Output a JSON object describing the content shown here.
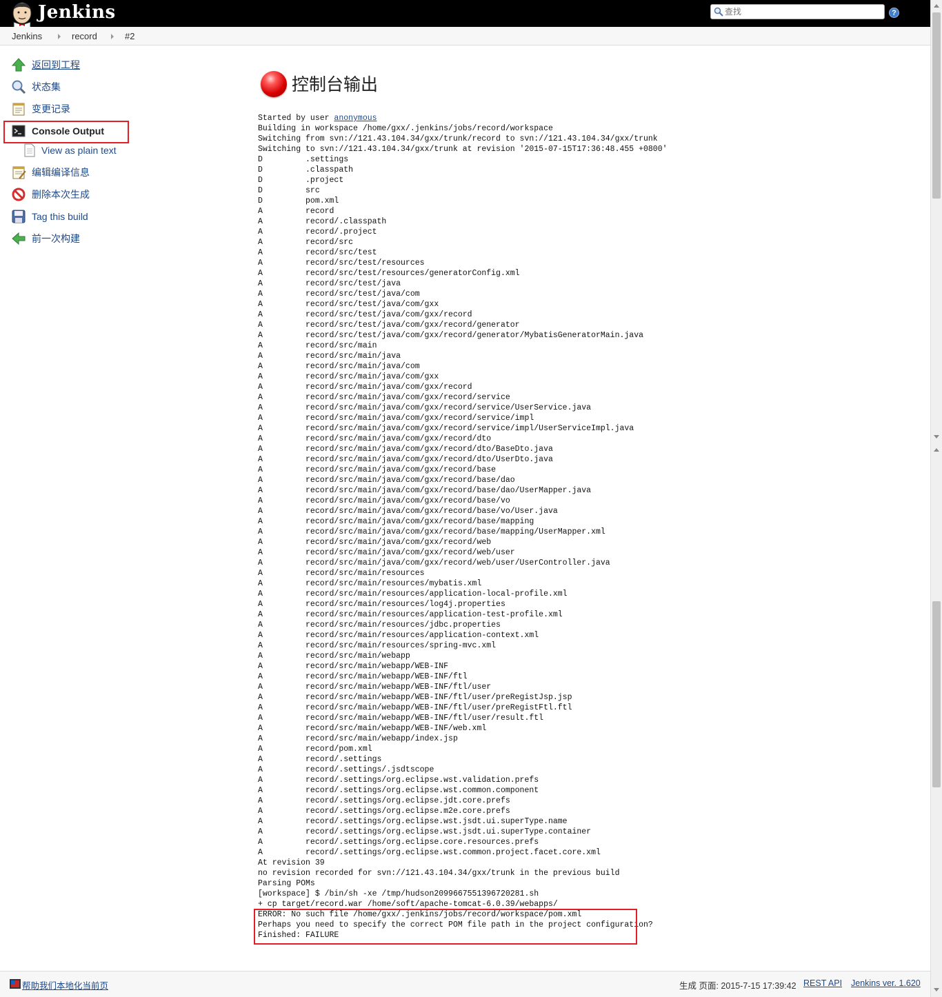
{
  "header": {
    "logo_text": "Jenkins",
    "search_placeholder": "查找",
    "help_label": "?"
  },
  "breadcrumb": [
    "Jenkins",
    "record",
    "#2"
  ],
  "sidebar": {
    "items": [
      {
        "label": "返回到工程",
        "icon": "up-arrow-icon"
      },
      {
        "label": "状态集",
        "icon": "magnifier-icon"
      },
      {
        "label": "变更记录",
        "icon": "notepad-icon"
      },
      {
        "label": "Console Output",
        "icon": "terminal-icon"
      },
      {
        "label": "View as plain text",
        "icon": "document-icon"
      },
      {
        "label": "编辑编译信息",
        "icon": "edit-notepad-icon"
      },
      {
        "label": "删除本次生成",
        "icon": "no-entry-icon"
      },
      {
        "label": "Tag this build",
        "icon": "save-icon"
      },
      {
        "label": "前一次构建",
        "icon": "left-arrow-icon"
      }
    ]
  },
  "main": {
    "title": "控制台输出",
    "status_color": "#d80000",
    "console": {
      "started_prefix": "Started by user ",
      "started_user": "anonymous",
      "lines": [
        "Building in workspace /home/gxx/.jenkins/jobs/record/workspace",
        "Switching from svn://121.43.104.34/gxx/trunk/record to svn://121.43.104.34/gxx/trunk",
        "Switching to svn://121.43.104.34/gxx/trunk at revision '2015-07-15T17:36:48.455 +0800'",
        "D         .settings",
        "D         .classpath",
        "D         .project",
        "D         src",
        "D         pom.xml",
        "A         record",
        "A         record/.classpath",
        "A         record/.project",
        "A         record/src",
        "A         record/src/test",
        "A         record/src/test/resources",
        "A         record/src/test/resources/generatorConfig.xml",
        "A         record/src/test/java",
        "A         record/src/test/java/com",
        "A         record/src/test/java/com/gxx",
        "A         record/src/test/java/com/gxx/record",
        "A         record/src/test/java/com/gxx/record/generator",
        "A         record/src/test/java/com/gxx/record/generator/MybatisGeneratorMain.java",
        "A         record/src/main",
        "A         record/src/main/java",
        "A         record/src/main/java/com",
        "A         record/src/main/java/com/gxx",
        "A         record/src/main/java/com/gxx/record",
        "A         record/src/main/java/com/gxx/record/service",
        "A         record/src/main/java/com/gxx/record/service/UserService.java",
        "A         record/src/main/java/com/gxx/record/service/impl",
        "A         record/src/main/java/com/gxx/record/service/impl/UserServiceImpl.java",
        "A         record/src/main/java/com/gxx/record/dto",
        "A         record/src/main/java/com/gxx/record/dto/BaseDto.java",
        "A         record/src/main/java/com/gxx/record/dto/UserDto.java",
        "A         record/src/main/java/com/gxx/record/base",
        "A         record/src/main/java/com/gxx/record/base/dao",
        "A         record/src/main/java/com/gxx/record/base/dao/UserMapper.java",
        "A         record/src/main/java/com/gxx/record/base/vo",
        "A         record/src/main/java/com/gxx/record/base/vo/User.java",
        "A         record/src/main/java/com/gxx/record/base/mapping",
        "A         record/src/main/java/com/gxx/record/base/mapping/UserMapper.xml",
        "A         record/src/main/java/com/gxx/record/web",
        "A         record/src/main/java/com/gxx/record/web/user",
        "A         record/src/main/java/com/gxx/record/web/user/UserController.java",
        "A         record/src/main/resources",
        "A         record/src/main/resources/mybatis.xml",
        "A         record/src/main/resources/application-local-profile.xml",
        "A         record/src/main/resources/log4j.properties",
        "A         record/src/main/resources/application-test-profile.xml",
        "A         record/src/main/resources/jdbc.properties",
        "A         record/src/main/resources/application-context.xml",
        "A         record/src/main/resources/spring-mvc.xml",
        "A         record/src/main/webapp",
        "A         record/src/main/webapp/WEB-INF",
        "A         record/src/main/webapp/WEB-INF/ftl",
        "A         record/src/main/webapp/WEB-INF/ftl/user",
        "A         record/src/main/webapp/WEB-INF/ftl/user/preRegistJsp.jsp",
        "A         record/src/main/webapp/WEB-INF/ftl/user/preRegistFtl.ftl",
        "A         record/src/main/webapp/WEB-INF/ftl/user/result.ftl",
        "A         record/src/main/webapp/WEB-INF/web.xml",
        "A         record/src/main/webapp/index.jsp",
        "A         record/pom.xml",
        "A         record/.settings",
        "A         record/.settings/.jsdtscope",
        "A         record/.settings/org.eclipse.wst.validation.prefs",
        "A         record/.settings/org.eclipse.wst.common.component",
        "A         record/.settings/org.eclipse.jdt.core.prefs",
        "A         record/.settings/org.eclipse.m2e.core.prefs",
        "A         record/.settings/org.eclipse.wst.jsdt.ui.superType.name",
        "A         record/.settings/org.eclipse.wst.jsdt.ui.superType.container",
        "A         record/.settings/org.eclipse.core.resources.prefs",
        "A         record/.settings/org.eclipse.wst.common.project.facet.core.xml",
        "At revision 39",
        "no revision recorded for svn://121.43.104.34/gxx/trunk in the previous build",
        "Parsing POMs",
        "[workspace] $ /bin/sh -xe /tmp/hudson2099667551396720281.sh",
        "+ cp target/record.war /home/soft/apache-tomcat-6.0.39/webapps/",
        "ERROR: No such file /home/gxx/.jenkins/jobs/record/workspace/pom.xml",
        "Perhaps you need to specify the correct POM file path in the project configuration?",
        "Finished: FAILURE"
      ]
    }
  },
  "footer": {
    "localize_link": "帮助我们本地化当前页",
    "generated_label": "生成 页面: 2015-7-15 17:39:42",
    "rest_api": "REST API",
    "version": "Jenkins ver. 1.620"
  }
}
